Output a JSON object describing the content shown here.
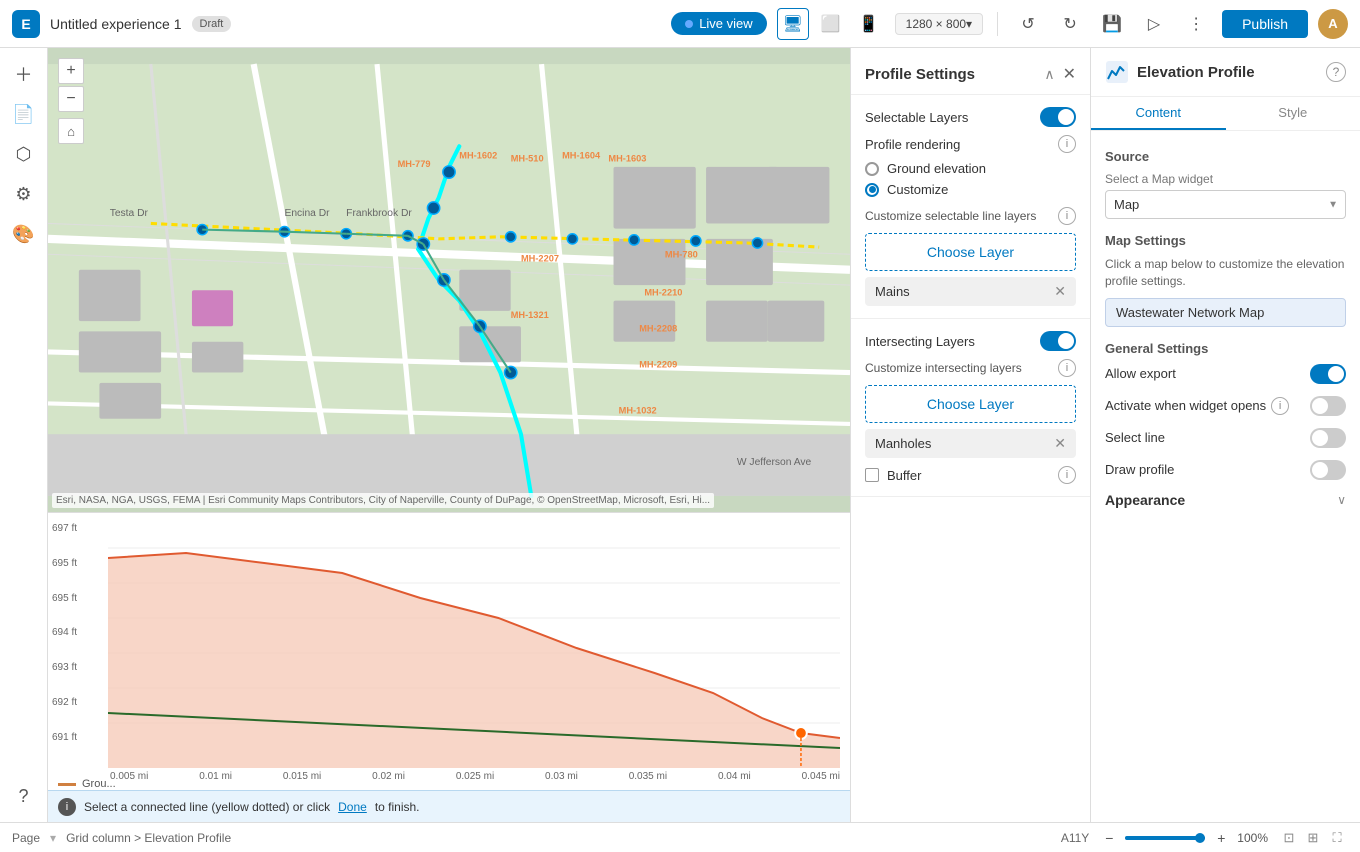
{
  "topbar": {
    "logo_text": "E",
    "title": "Untitled experience 1",
    "draft_label": "Draft",
    "liveview_label": "Live view",
    "resolution": "1280 × 800▾",
    "publish_label": "Publish",
    "avatar_text": "A"
  },
  "left_sidebar": {
    "icons": [
      "+",
      "☰",
      "⬡",
      "⚙",
      "🎨",
      "?"
    ]
  },
  "map_panel": {
    "title": "Wastewater Network Map",
    "attribution": "Esri, NASA, NGA, USGS, FEMA | Esri Community Maps Contributors, City of Naperville, County of DuPage, © OpenStreetMap, Microsoft, Esri, Hi..."
  },
  "profile_settings": {
    "title": "Profile Settings",
    "selectable_layers_label": "Selectable Layers",
    "selectable_layers_enabled": true,
    "profile_rendering_label": "Profile rendering",
    "ground_elevation_label": "Ground elevation",
    "customize_label": "Customize",
    "customize_selected": true,
    "customize_selectable_line_layers_label": "Customize selectable line layers",
    "choose_layer_label": "Choose Layer",
    "mains_label": "Mains",
    "intersecting_layers_title": "Intersecting Layers",
    "intersecting_layers_enabled": true,
    "customize_intersecting_label": "Customize intersecting layers",
    "choose_layer_label2": "Choose Layer",
    "manholes_label": "Manholes",
    "buffer_label": "Buffer"
  },
  "elevation_profile": {
    "title": "Elevation Profile",
    "tabs": [
      "Content",
      "Style"
    ],
    "active_tab": "Content",
    "source_title": "Source",
    "select_map_widget_label": "Select a Map widget",
    "map_dropdown": "Map",
    "map_settings_title": "Map Settings",
    "map_settings_desc": "Click a map below to customize the elevation profile settings.",
    "map_chip": "Wastewater Network Map",
    "general_settings_title": "General Settings",
    "allow_export_label": "Allow export",
    "allow_export_enabled": true,
    "activate_when_opens_label": "Activate when widget opens",
    "activate_when_opens_enabled": false,
    "select_line_label": "Select line",
    "select_line_enabled": false,
    "draw_profile_label": "Draw profile",
    "draw_profile_enabled": false,
    "appearance_title": "Appearance"
  },
  "chart": {
    "y_labels": [
      "697 ft",
      "695 ft",
      "695 ft",
      "694 ft",
      "693 ft",
      "692 ft",
      "691 ft"
    ],
    "x_labels": [
      "0.005 mi",
      "0.01 mi",
      "0.015 mi",
      "0.02 mi",
      "0.025 mi",
      "0.03 mi",
      "0.035 mi",
      "0.04 mi",
      "0.045 mi"
    ],
    "legend_label": "Grou..."
  },
  "bottom_bar": {
    "page_label": "Page",
    "breadcrumb": "Grid column  >  Elevation Profile",
    "position": "A11Y",
    "zoom_minus": "−",
    "zoom_plus": "+",
    "zoom_value": "100%"
  },
  "info_bar": {
    "message": "Select a connected line (yellow dotted) or click",
    "link_text": "Done",
    "message_end": "to finish."
  }
}
